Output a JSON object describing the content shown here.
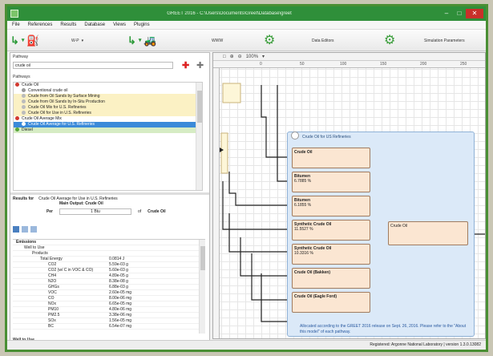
{
  "window": {
    "title": "GREET 2016 - C:\\Users\\Documents\\Greet\\Database\\greet",
    "min": "–",
    "max": "□",
    "close": "✕"
  },
  "menu": [
    "File",
    "References",
    "Results",
    "Database",
    "Views",
    "Plugins"
  ],
  "toolbar": {
    "item1": "W-P",
    "item2": "WWW",
    "item3": "Data Editors",
    "item4": "Simulation Parameters"
  },
  "left": {
    "filter_label": "Pathway",
    "search_value": "crude oil",
    "tree_header": "Pathways",
    "tree": [
      {
        "label": "Crude Oil",
        "style": "root"
      },
      {
        "label": "Conventional crude oil",
        "style": "plain"
      },
      {
        "label": "Crude from Oil Sands by Surface Mining",
        "style": "yellow"
      },
      {
        "label": "Crude from Oil Sands by In-Situ Production",
        "style": "yellow"
      },
      {
        "label": "Crude Oil Mix for U.S. Refineries",
        "style": "yellow"
      },
      {
        "label": "Crude Oil for Use in U.S. Refineries",
        "style": "yellow"
      },
      {
        "label": "Crude Oil Average Mix",
        "style": "root2"
      },
      {
        "label": "Crude Oil Average for U.S. Refineries",
        "style": "selected"
      },
      {
        "label": "Diesel",
        "style": "green"
      }
    ],
    "results_label": "Results for",
    "results_value": "Crude Oil Average for Use in U.S. Refineries",
    "main_output_label": "Main Output: Crude Oil",
    "per_label": "Per",
    "per_value": "1 Btu",
    "of_label": "of",
    "of_value": "Crude Oil",
    "grid": [
      {
        "k": "Emissions",
        "v": "",
        "indent": 0,
        "bold": true
      },
      {
        "k": "Well to Use",
        "v": "",
        "indent": 1,
        "bold": false
      },
      {
        "k": "Products",
        "v": "",
        "indent": 2,
        "bold": false
      },
      {
        "k": "Total Energy",
        "v": "0.0814 J",
        "indent": 3,
        "bold": false
      },
      {
        "k": "CO2",
        "v": "5.59e-03 g",
        "indent": 4,
        "bold": false
      },
      {
        "k": "CO2 (w/ C in VOC & CO)",
        "v": "5.60e-03 g",
        "indent": 4,
        "bold": false
      },
      {
        "k": "CH4",
        "v": "4.89e-05 g",
        "indent": 4,
        "bold": false
      },
      {
        "k": "N2O",
        "v": "8.38e-08 g",
        "indent": 4,
        "bold": false
      },
      {
        "k": "GHGs",
        "v": "6.88e-03 g",
        "indent": 4,
        "bold": false
      },
      {
        "k": "VOC",
        "v": "2.60e-05 mg",
        "indent": 4,
        "bold": false
      },
      {
        "k": "CO",
        "v": "8.00e-06 mg",
        "indent": 4,
        "bold": false
      },
      {
        "k": "NOx",
        "v": "6.65e-05 mg",
        "indent": 4,
        "bold": false
      },
      {
        "k": "PM10",
        "v": "4.80e-06 mg",
        "indent": 4,
        "bold": false
      },
      {
        "k": "PM2.5",
        "v": "3.38e-06 mg",
        "indent": 4,
        "bold": false
      },
      {
        "k": "SOx",
        "v": "1.56e-05 mg",
        "indent": 4,
        "bold": false
      },
      {
        "k": "BC",
        "v": "6.54e-07 mg",
        "indent": 4,
        "bold": false
      }
    ],
    "footer": "Well to Use"
  },
  "canvas": {
    "tools": [
      "□",
      "⊕",
      "⊖",
      "100%",
      "▾"
    ],
    "ruler_ticks": [
      "0",
      "50",
      "100",
      "150",
      "200",
      "250",
      "300"
    ],
    "group_title": "Crude Oil for US Refineries",
    "nodes": [
      {
        "l1": "Crude Oil",
        "l2": ""
      },
      {
        "l1": "Bitumen",
        "l2": "6.7885 %"
      },
      {
        "l1": "Bitumen",
        "l2": "6.1855 %"
      },
      {
        "l1": "Synthetic Crude Oil",
        "l2": "11.5527 %"
      },
      {
        "l1": "Synthetic Crude Oil",
        "l2": "10.3316 %"
      },
      {
        "l1": "Crude Oil (Bakken)",
        "l2": ""
      },
      {
        "l1": "Crude Oil (Eagle Ford)",
        "l2": ""
      }
    ],
    "out_node": "Crude Oil",
    "note": "Allocated according to the GREET 2016 release on Sept. 26, 2016. Please refer to the \"About this model\" of each pathway."
  },
  "status": "Registered: Argonne National Laboratory  |  version 1.3.0.13082"
}
